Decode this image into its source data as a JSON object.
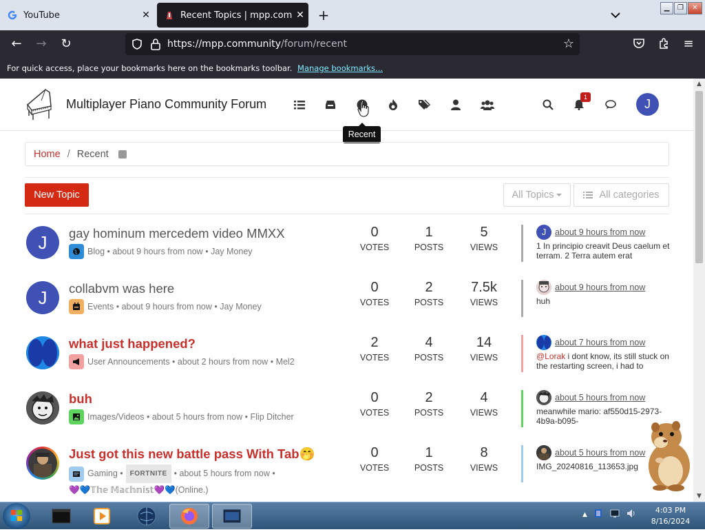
{
  "browser": {
    "tabs": [
      {
        "title": "YouTube",
        "favicon": "google-g-icon",
        "active": false
      },
      {
        "title": "Recent Topics | mpp.community",
        "favicon": "piano-favicon-icon",
        "active": true
      }
    ],
    "url_host": "https://mpp.community",
    "url_path": "/forum/recent",
    "bookmarks_text": "For quick access, place your bookmarks here on the bookmarks toolbar.",
    "bookmarks_link": "Manage bookmarks..."
  },
  "site": {
    "title": "Multiplayer Piano Community Forum",
    "nav": [
      "list-icon",
      "inbox-icon",
      "clock-icon",
      "fire-icon",
      "tags-icon",
      "user-icon",
      "users-icon"
    ],
    "notification_count": "1",
    "user_initial": "J",
    "tooltip": "Recent"
  },
  "breadcrumb": {
    "home": "Home",
    "sep": "/",
    "current": "Recent"
  },
  "toolbar": {
    "new_topic": "New Topic",
    "all_topics": "All Topics",
    "all_categories": "All categories"
  },
  "labels": {
    "votes": "VOTES",
    "posts": "POSTS",
    "views": "VIEWS",
    "dot": "•"
  },
  "topics": [
    {
      "title": "gay hominum mercedem video MMXX",
      "unread": false,
      "avatar_letter": "J",
      "avatar_color": "#3f51b5",
      "category": "Blog",
      "category_color": "#2e8bd6",
      "time": "about 9 hours from now",
      "author": "Jay Money",
      "votes": "0",
      "posts": "1",
      "views": "5",
      "last_time": "about 9 hours from now",
      "last_mini_letter": "J",
      "last_snippet": "1 In principio creavit Deus caelum et terram. 2 Terra autem erat",
      "border_color": "#aaaaaa"
    },
    {
      "title": "collabvm was here",
      "unread": false,
      "avatar_letter": "J",
      "avatar_color": "#3f51b5",
      "category": "Events",
      "category_color": "#f0b060",
      "time": "about 9 hours from now",
      "author": "Jay Money",
      "votes": "0",
      "posts": "2",
      "views": "7.5k",
      "last_time": "about 9 hours from now",
      "last_mini_letter": "",
      "last_snippet": "huh",
      "border_color": "#aaaaaa"
    },
    {
      "title": "what just happened?",
      "unread": true,
      "avatar_letter": "",
      "avatar_color": "#2f63d6",
      "category": "User Announcements",
      "category_color": "#f2a0a0",
      "time": "about 2 hours from now",
      "author": "Mel2",
      "votes": "2",
      "posts": "4",
      "views": "14",
      "last_time": "about 7 hours from now",
      "last_mini_letter": "",
      "last_mention": "@Lorak",
      "last_snippet": " i dont know, its still stuck on the restarting screen, i had to",
      "border_color": "#f2a0a0"
    },
    {
      "title": "buh",
      "unread": true,
      "avatar_letter": "",
      "avatar_color": "#777777",
      "category": "Images/Videos",
      "category_color": "#5ed35e",
      "time": "about 5 hours from now",
      "author": "Flip Ditcher",
      "votes": "0",
      "posts": "2",
      "views": "4",
      "last_time": "about 5 hours from now",
      "last_mini_letter": "",
      "last_snippet": "meanwhile mario: af550d15-2973-4b9a-b095-",
      "border_color": "#5ed35e"
    },
    {
      "title": "Just got this new battle pass With Tab🤭",
      "unread": true,
      "avatar_letter": "",
      "avatar_color": "#4a4a4a",
      "category": "Gaming",
      "category_color": "#9ecbee",
      "tag": "FORTNITE",
      "time": "about 5 hours from now",
      "author": "💜💙𝕋𝕙𝕖 𝕄𝕒𝕔𝕙𝕟𝕚𝕤𝕥💜💙(Online.)",
      "votes": "0",
      "posts": "1",
      "views": "8",
      "last_time": "about 5 hours from now",
      "last_mini_letter": "",
      "last_snippet": "IMG_20240816_113653.jpg",
      "border_color": "#9ecbee"
    }
  ],
  "taskbar": {
    "items": [
      "terminal-app-icon",
      "media-player-icon",
      "globe-icon",
      "firefox-icon",
      "vm-window-icon"
    ],
    "time": "4:03 PM",
    "date": "8/16/2024"
  }
}
